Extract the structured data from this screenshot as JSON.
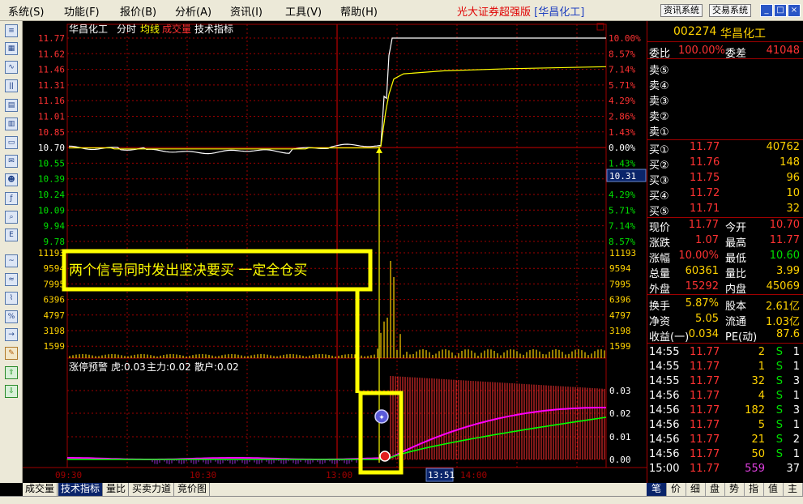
{
  "menubar": {
    "items": [
      "系统(S)",
      "功能(F)",
      "报价(B)",
      "分析(A)",
      "资讯(I)",
      "工具(V)",
      "帮助(H)"
    ],
    "app_title": "光大证券超强版",
    "stock_title": "[华昌化工]",
    "info_button": "资讯系统",
    "trade_button": "交易系统"
  },
  "chart": {
    "header": {
      "name": "华昌化工",
      "tab1": "分时",
      "tab2": "均线",
      "tab3": "成交量",
      "tab4": "技术指标"
    },
    "price_ticks": [
      "11.77",
      "11.62",
      "11.46",
      "11.31",
      "11.16",
      "11.01",
      "10.85",
      "10.70",
      "10.55",
      "10.39",
      "10.24",
      "10.09",
      "9.94",
      "9.78"
    ],
    "pct_ticks": [
      "10.00%",
      "8.57%",
      "7.14%",
      "5.71%",
      "4.29%",
      "2.86%",
      "1.43%",
      "0.00%",
      "1.43%",
      "2.86%",
      "4.29%",
      "5.71%",
      "7.14%",
      "8.57%"
    ],
    "cursor_price": "10.31",
    "volume_ticks": [
      "11193",
      "9594",
      "7995",
      "6396",
      "4797",
      "3198",
      "1599"
    ],
    "indicator_header": {
      "name": "涨停预警",
      "tiger": "虎:0.03",
      "main": "主力:0.02",
      "retail": "散户:0.02"
    },
    "indicator_ticks": [
      "0.03",
      "0.02",
      "0.01",
      "0.00"
    ],
    "time_ticks": [
      "09:30",
      "10:30",
      "13:00",
      "14:00"
    ],
    "cursor_time": "13:51",
    "annotation": "两个信号同时发出坚决要买   一定全仓买",
    "colors": {
      "price_line": "#ffffff",
      "avg_line": "#ffff00",
      "up": "#ff3232",
      "down": "#00e000",
      "grid": "#a00000",
      "highlight": "#ffff00",
      "tiger_line": "#ff00ff",
      "main_line": "#00ff00"
    }
  },
  "quote": {
    "code": "002274",
    "name": "华昌化工",
    "weibi_label": "委比",
    "weibi": "100.00%",
    "weicha_label": "委差",
    "weicha": "41048",
    "sells": [
      {
        "label": "卖⑤",
        "price": "",
        "vol": ""
      },
      {
        "label": "卖④",
        "price": "",
        "vol": ""
      },
      {
        "label": "卖③",
        "price": "",
        "vol": ""
      },
      {
        "label": "卖②",
        "price": "",
        "vol": ""
      },
      {
        "label": "卖①",
        "price": "",
        "vol": ""
      }
    ],
    "buys": [
      {
        "label": "买①",
        "price": "11.77",
        "vol": "40762"
      },
      {
        "label": "买②",
        "price": "11.76",
        "vol": "148"
      },
      {
        "label": "买③",
        "price": "11.75",
        "vol": "96"
      },
      {
        "label": "买④",
        "price": "11.72",
        "vol": "10"
      },
      {
        "label": "买⑤",
        "price": "11.71",
        "vol": "32"
      }
    ],
    "stats1": [
      {
        "l1": "现价",
        "v1": "11.77",
        "l2": "今开",
        "v2": "10.70"
      },
      {
        "l1": "涨跌",
        "v1": "1.07",
        "l2": "最高",
        "v2": "11.77"
      },
      {
        "l1": "涨幅",
        "v1": "10.00%",
        "l2": "最低",
        "v2": "10.60"
      },
      {
        "l1": "总量",
        "v1": "60361",
        "l2": "量比",
        "v2": "3.99"
      },
      {
        "l1": "外盘",
        "v1": "15292",
        "l2": "内盘",
        "v2": "45069"
      }
    ],
    "stats2": [
      {
        "l1": "换手",
        "v1": "5.87%",
        "l2": "股本",
        "v2": "2.61亿"
      },
      {
        "l1": "净资",
        "v1": "5.05",
        "l2": "流通",
        "v2": "1.03亿"
      },
      {
        "l1": "收益(一)",
        "v1": "0.034",
        "l2": "PE(动)",
        "v2": "87.6"
      }
    ],
    "trades": [
      {
        "time": "14:55",
        "price": "11.77",
        "vol": "2",
        "flag": "S",
        "n": "1"
      },
      {
        "time": "14:55",
        "price": "11.77",
        "vol": "1",
        "flag": "S",
        "n": "1"
      },
      {
        "time": "14:55",
        "price": "11.77",
        "vol": "32",
        "flag": "S",
        "n": "3"
      },
      {
        "time": "14:56",
        "price": "11.77",
        "vol": "4",
        "flag": "S",
        "n": "1"
      },
      {
        "time": "14:56",
        "price": "11.77",
        "vol": "182",
        "flag": "S",
        "n": "3"
      },
      {
        "time": "14:56",
        "price": "11.77",
        "vol": "5",
        "flag": "S",
        "n": "1"
      },
      {
        "time": "14:56",
        "price": "11.77",
        "vol": "21",
        "flag": "S",
        "n": "2"
      },
      {
        "time": "14:56",
        "price": "11.77",
        "vol": "50",
        "flag": "S",
        "n": "1"
      },
      {
        "time": "15:00",
        "price": "11.77",
        "vol": "559",
        "flag": "",
        "n": "37"
      }
    ]
  },
  "bottom_tabs": [
    "成交量",
    "技术指标",
    "量比",
    "买卖力道",
    "竞价图"
  ],
  "side_tabs": [
    "笔",
    "价",
    "细",
    "盘",
    "势",
    "指",
    "值",
    "主"
  ]
}
